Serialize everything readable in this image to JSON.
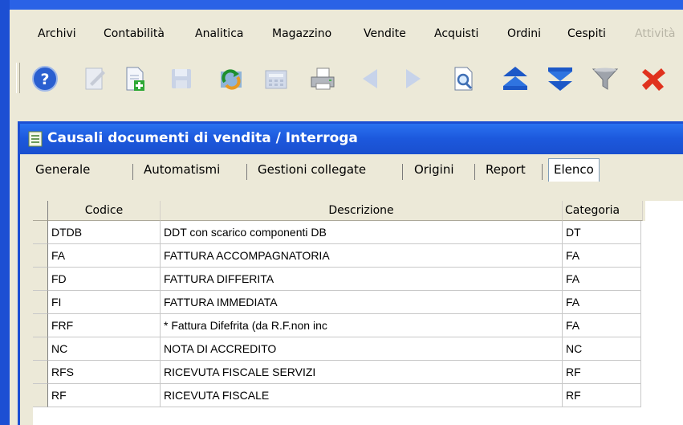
{
  "colors": {
    "titlebar": "#1c58dc",
    "desktop": "#1f55d8",
    "chrome": "#ece9d8"
  },
  "menu": [
    {
      "label": "Archivi",
      "enabled": true
    },
    {
      "label": "Contabilità",
      "enabled": true
    },
    {
      "label": "Analitica",
      "enabled": true
    },
    {
      "label": "Magazzino",
      "enabled": true
    },
    {
      "label": "Vendite",
      "enabled": true
    },
    {
      "label": "Acquisti",
      "enabled": true
    },
    {
      "label": "Ordini",
      "enabled": true
    },
    {
      "label": "Cespiti",
      "enabled": true
    },
    {
      "label": "Attività",
      "enabled": false
    }
  ],
  "toolbar": [
    {
      "icon": "help-icon",
      "enabled": true
    },
    {
      "icon": "edit-document-icon",
      "enabled": false
    },
    {
      "icon": "new-document-icon",
      "enabled": true
    },
    {
      "icon": "save-icon",
      "enabled": false
    },
    {
      "icon": "refresh-icon",
      "enabled": true
    },
    {
      "icon": "calculator-icon",
      "enabled": false
    },
    {
      "icon": "print-icon",
      "enabled": true
    },
    {
      "icon": "previous-icon",
      "enabled": false
    },
    {
      "icon": "next-icon",
      "enabled": false
    },
    {
      "icon": "preview-icon",
      "enabled": true
    },
    {
      "icon": "move-up-icon",
      "enabled": true
    },
    {
      "icon": "move-down-icon",
      "enabled": true
    },
    {
      "icon": "filter-icon",
      "enabled": true
    },
    {
      "icon": "delete-icon",
      "enabled": true
    }
  ],
  "window": {
    "title": "Causali documenti di vendita / Interroga",
    "tabs": [
      {
        "label": "Generale"
      },
      {
        "label": "Automatismi"
      },
      {
        "label": "Gestioni collegate"
      },
      {
        "label": "Origini"
      },
      {
        "label": "Report"
      },
      {
        "label": "Elenco",
        "active": true
      }
    ]
  },
  "grid": {
    "columns": [
      "Codice",
      "Descrizione",
      "Categoria"
    ],
    "rows": [
      [
        "DTDB",
        "DDT con scarico componenti DB",
        "DT"
      ],
      [
        "FA",
        "FATTURA ACCOMPAGNATORIA",
        "FA"
      ],
      [
        "FD",
        "FATTURA DIFFERITA",
        "FA"
      ],
      [
        "FI",
        "FATTURA IMMEDIATA",
        "FA"
      ],
      [
        "FRF",
        "* Fattura Difefrita (da R.F.non inc",
        "FA"
      ],
      [
        "NC",
        "NOTA DI ACCREDITO",
        "NC"
      ],
      [
        "RFS",
        "RICEVUTA FISCALE SERVIZI",
        "RF"
      ],
      [
        "RF",
        "RICEVUTA FISCALE",
        "RF"
      ]
    ]
  }
}
